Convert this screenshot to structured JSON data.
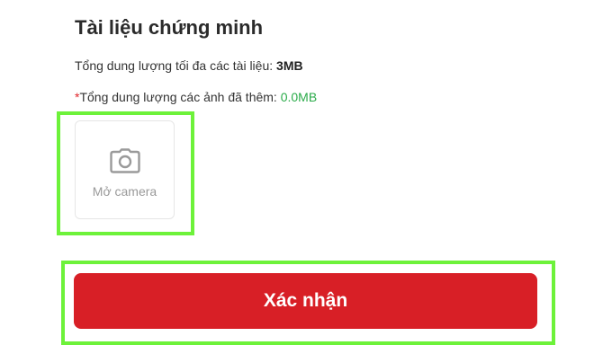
{
  "section": {
    "title": "Tài liệu chứng minh",
    "limit_label": "Tổng dung lượng tối đa các tài liệu: ",
    "limit_value": "3MB",
    "required_mark": "*",
    "added_label": "Tổng dung lượng các ảnh đã thêm: ",
    "added_value": "0.0MB"
  },
  "camera": {
    "icon": "camera-icon",
    "label": "Mở camera"
  },
  "actions": {
    "confirm_label": "Xác nhận"
  },
  "colors": {
    "accent_red": "#d81f26",
    "highlight_green": "#6df23a",
    "success_green": "#2bab4a",
    "required_red": "#e0262a"
  }
}
